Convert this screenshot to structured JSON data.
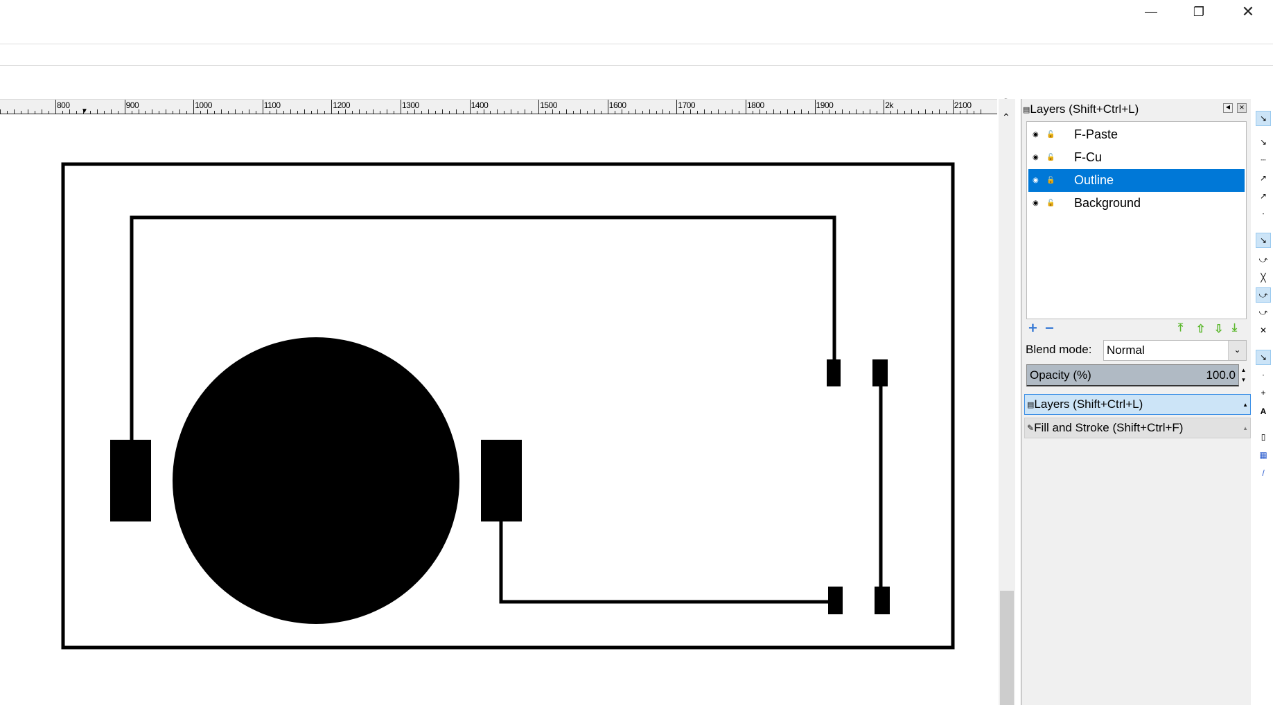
{
  "window": {
    "minimize_icon": "minimize-icon",
    "restore_icon": "restore-icon",
    "close_icon": "close-icon"
  },
  "ruler": {
    "labels": [
      "800",
      "900",
      "1000",
      "1100",
      "1200",
      "1300",
      "1400",
      "1500",
      "1600",
      "1700",
      "1800",
      "1900",
      "2k",
      "2100"
    ]
  },
  "layers_panel": {
    "title": "Layers (Shift+Ctrl+L)",
    "layers": [
      {
        "name": "F-Paste",
        "selected": false
      },
      {
        "name": "F-Cu",
        "selected": false
      },
      {
        "name": "Outline",
        "selected": true
      },
      {
        "name": "Background",
        "selected": false
      }
    ],
    "blend_mode_label": "Blend mode:",
    "blend_mode_value": "Normal",
    "opacity_label": "Opacity (%)",
    "opacity_value": "100.0"
  },
  "docked_tabs": [
    {
      "label": "Layers (Shift+Ctrl+L)",
      "active": true
    },
    {
      "label": "Fill and Stroke (Shift+Ctrl+F)",
      "active": false
    }
  ],
  "colors": {
    "selection": "#0078d7",
    "accent_light": "#cce4f7",
    "arrow_green": "#5cb82e"
  }
}
